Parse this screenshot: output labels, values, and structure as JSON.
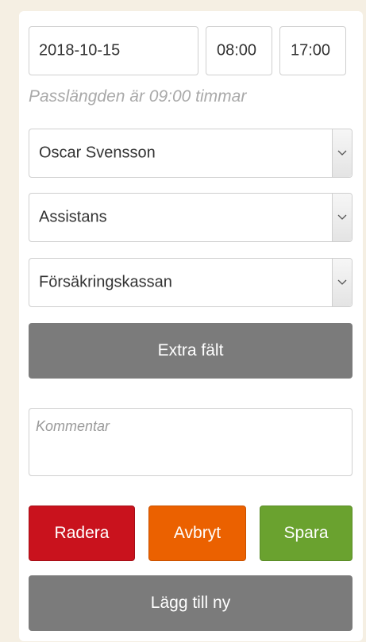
{
  "shift": {
    "date": "2018-10-15",
    "start_time": "08:00",
    "end_time": "17:00",
    "duration_text": "Passlängden är 09:00 timmar"
  },
  "selects": {
    "person": "Oscar Svensson",
    "type": "Assistans",
    "payer": "Försäkringskassan"
  },
  "buttons": {
    "extra_fields": "Extra fält",
    "delete": "Radera",
    "cancel": "Avbryt",
    "save": "Spara",
    "add_new": "Lägg till ny"
  },
  "comment": {
    "placeholder": "Kommentar"
  },
  "colors": {
    "delete": "#c9121d",
    "cancel": "#eb6100",
    "save": "#6aa22f",
    "neutral": "#7b7b7b"
  },
  "icons": {
    "select_caret": "chevron-down-icon"
  }
}
